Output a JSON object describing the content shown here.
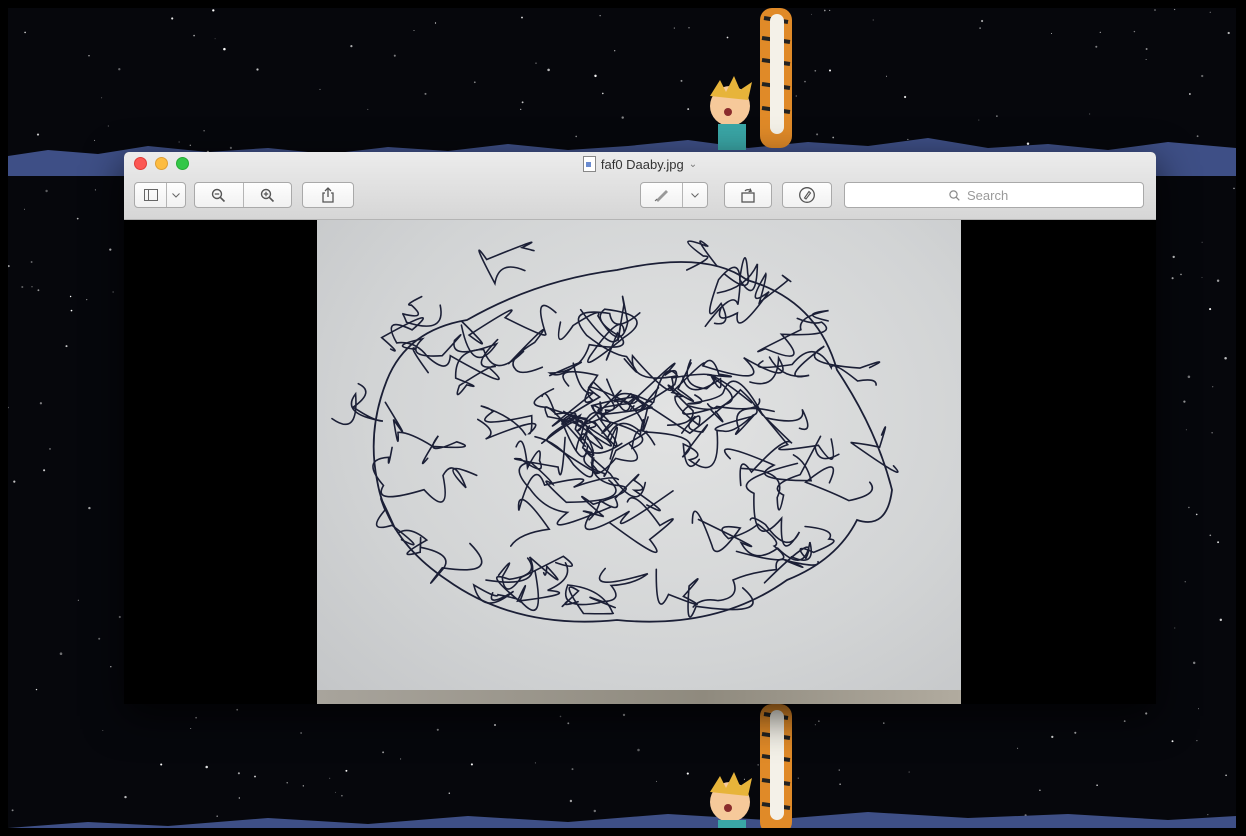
{
  "window": {
    "title": "faf0 Daaby.jpg",
    "title_chevron": "⌄",
    "traffic_lights": {
      "close": "#fc5753",
      "minimize": "#fdbc40",
      "zoom": "#33c748"
    }
  },
  "toolbar": {
    "sidebar_toggle_icon": "sidebar-icon",
    "zoom_out_icon": "zoom-out-icon",
    "zoom_in_icon": "zoom-in-icon",
    "share_icon": "share-icon",
    "markup_icon": "markup-pen-icon",
    "markup_menu_icon": "chevron-down-icon",
    "rotate_icon": "rotate-icon",
    "annotate_icon": "markup-toolbar-icon",
    "search_placeholder": "Search"
  },
  "desktop": {
    "wallpaper": "night sky with cartoon characters",
    "colors": {
      "sky": "#06070c",
      "mountains": "#3e4f86"
    }
  },
  "image": {
    "subject": "hand-drawn maze on paper",
    "ink_color": "#1b1f36"
  }
}
